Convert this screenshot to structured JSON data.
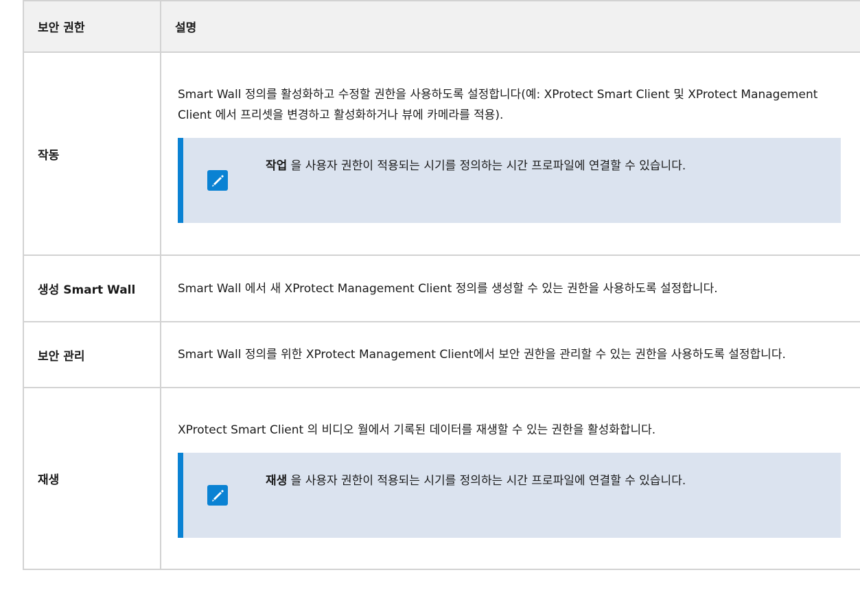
{
  "table": {
    "headers": {
      "permission": "보안 권한",
      "description": "설명"
    },
    "rows": [
      {
        "permission": "작동",
        "description": "Smart Wall 정의를 활성화하고 수정할 권한을 사용하도록 설정합니다(예: XProtect Smart Client 및 XProtect Management Client 에서 프리셋을 변경하고 활성화하거나 뷰에 카메라를 적용).",
        "note": {
          "strong": "작업",
          "text": " 을 사용자 권한이 적용되는 시기를 정의하는 시간 프로파일에 연결할 수 있습니다.",
          "icon": "pencil-icon"
        }
      },
      {
        "permission": "생성 Smart Wall",
        "description": "Smart Wall 에서 새 XProtect Management Client 정의를 생성할 수 있는 권한을 사용하도록 설정합니다."
      },
      {
        "permission": "보안 관리",
        "description": "Smart Wall 정의를 위한 XProtect Management Client에서 보안 권한을 관리할 수 있는 권한을 사용하도록 설정합니다."
      },
      {
        "permission": "재생",
        "description": "XProtect Smart Client 의 비디오 월에서 기록된 데이터를 재생할 수 있는 권한을 활성화합니다.",
        "note": {
          "strong": "재생",
          "text": " 을 사용자 권한이 적용되는 시기를 정의하는 시간 프로파일에 연결할 수 있습니다.",
          "icon": "pencil-icon"
        }
      }
    ]
  },
  "colors": {
    "note_accent": "#0a82d3",
    "note_background": "#dbe3ef",
    "header_background": "#f1f1f1",
    "border": "#d2d2d2"
  }
}
